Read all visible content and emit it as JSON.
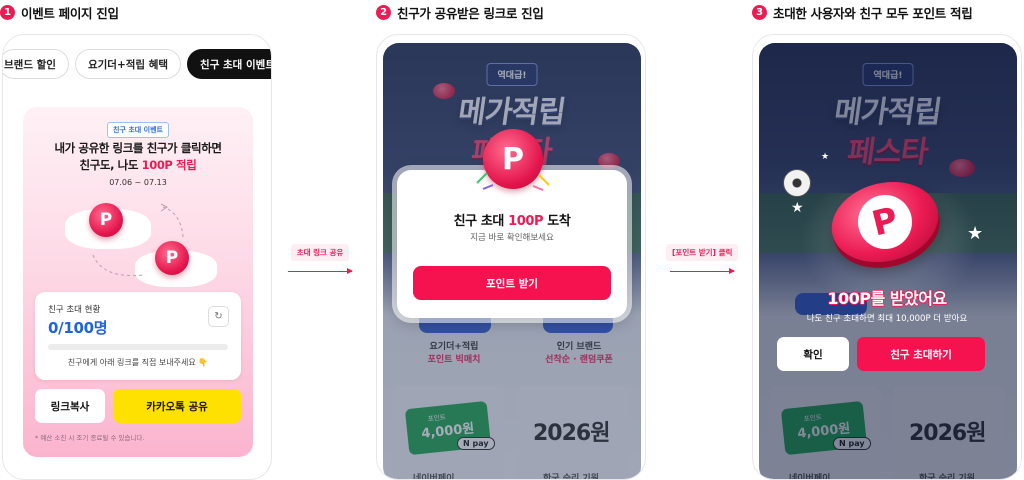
{
  "steps": [
    {
      "num": "1",
      "title": "이벤트 페이지 진입"
    },
    {
      "num": "2",
      "title": "친구가 공유받은 링크로 진입"
    },
    {
      "num": "3",
      "title": "초대한 사용자와 친구 모두 포인트 적립"
    }
  ],
  "panel1": {
    "tabs": [
      "브랜드 할인",
      "요기더+적립 혜택",
      "친구 초대 이벤트"
    ],
    "badge": "친구 초대 이벤트",
    "title_line1": "내가 공유한 링크를 친구가 클릭하면",
    "title_line2_prefix": "친구도, 나도 ",
    "title_line2_highlight": "100P 적립",
    "date_range": "07.06 ~ 07.13",
    "coin_letter": "P",
    "status": {
      "label": "친구 초대 현황",
      "count": "0/100명",
      "progress": 0,
      "hint": "친구에게 아래 링크를 직접 보내주세요 👇",
      "refresh_icon": "↻"
    },
    "copy_button": "링크복사",
    "kakao_button": "카카오톡 공유",
    "footnote": "* 예산 소진 시 조기 종료될 수 있습니다."
  },
  "arrows": [
    {
      "label": "초대 링크 공유"
    },
    {
      "label": "[포인트 받기] 클릭"
    }
  ],
  "hero": {
    "tag": "역대급!",
    "title": "메가적립",
    "title2": "페스타"
  },
  "tiles": {
    "left_label1": "요기더+적립",
    "left_label2": "포인트 빅매치",
    "right_label1": "인기 브랜드",
    "right_label2": "선착순 · 랜덤쿠폰",
    "npay_top": "포인트",
    "npay_amount": "4,000원",
    "npay_pill": "N pay",
    "year": "2026원",
    "left_bottom": "네이버페이",
    "right_bottom": "한국 승리 기원"
  },
  "panel2": {
    "coin_letter": "P",
    "modal_title_prefix": "친구 초대 ",
    "modal_title_highlight": "100P",
    "modal_title_suffix": " 도착",
    "modal_sub": "지금 바로 확인해보세요",
    "button": "포인트 받기"
  },
  "panel3": {
    "coin_letter": "P",
    "result_title": "100P를 받았어요",
    "result_sub": "나도 친구 초대하면 최대 10,000P 더 받아요",
    "ok_button": "확인",
    "invite_button": "친구 초대하기",
    "star_glyph": "★"
  },
  "colors": {
    "accent": "#ec1b54",
    "kakao": "#ffe100",
    "count_blue": "#1e63e0"
  }
}
